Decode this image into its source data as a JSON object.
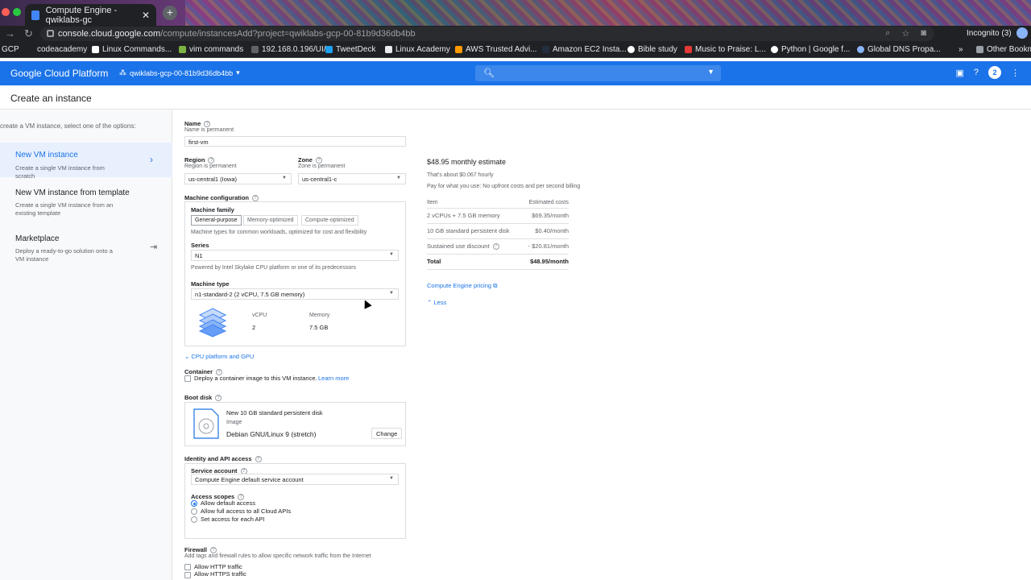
{
  "browser": {
    "tab_title": "Compute Engine - qwiklabs-gc",
    "url_host": "console.cloud.google.com",
    "url_path": "/compute/instancesAdd?project=qwiklabs-gcp-00-81b9d36db4bb",
    "incognito": "Incognito (3)",
    "bookmarks": [
      "GCP",
      "codeacademy",
      "Linux Commands...",
      "vim commands",
      "192.168.0.196/UI/",
      "TweetDeck",
      "Linux Academy",
      "AWS Trusted Advi...",
      "Amazon EC2 Insta...",
      "Bible study",
      "Music to Praise: L...",
      "Python | Google f...",
      "Global DNS Propa...",
      "»",
      "Other Bookm"
    ]
  },
  "header": {
    "title": "Google Cloud Platform",
    "project": "qwiklabs-gcp-00-81b9d36db4bb",
    "notifications": "2"
  },
  "page": {
    "title": "Create an instance"
  },
  "sidebar": {
    "intro": "create a VM instance, select one of the options:",
    "options": [
      {
        "title": "New VM instance",
        "desc": "Create a single VM instance from scratch"
      },
      {
        "title": "New VM instance from template",
        "desc": "Create a single VM instance from an existing template"
      },
      {
        "title": "Marketplace",
        "desc": "Deploy a ready-to-go solution onto a VM instance"
      }
    ]
  },
  "form": {
    "name_label": "Name",
    "name_hint": "Name is permanent",
    "name_value": "first-vm",
    "region_label": "Region",
    "region_hint": "Region is permanent",
    "region_value": "us-central1 (Iowa)",
    "zone_label": "Zone",
    "zone_hint": "Zone is permanent",
    "zone_value": "us-central1-c",
    "machine_config_label": "Machine configuration",
    "machine_family_label": "Machine family",
    "families": [
      "General-purpose",
      "Memory-optimized",
      "Compute-optimized"
    ],
    "family_desc": "Machine types for common workloads, optimized for cost and flexibility",
    "series_label": "Series",
    "series_value": "N1",
    "series_desc": "Powered by Intel Skylake CPU platform or one of its predecessors",
    "machine_type_label": "Machine type",
    "machine_type_value": "n1-standard-2 (2 vCPU, 7.5 GB memory)",
    "vcpu_label": "vCPU",
    "vcpu_value": "2",
    "memory_label": "Memory",
    "memory_value": "7.5 GB",
    "cpu_platform_link": "CPU platform and GPU",
    "container_label": "Container",
    "container_text": "Deploy a container image to this VM instance.",
    "container_link": "Learn more",
    "boot_disk_label": "Boot disk",
    "boot_disk_title": "New 10 GB standard persistent disk",
    "boot_disk_image_label": "Image",
    "boot_disk_image": "Debian GNU/Linux 9 (stretch)",
    "change_button": "Change",
    "identity_label": "Identity and API access",
    "service_account_label": "Service account",
    "service_account_value": "Compute Engine default service account",
    "access_scopes_label": "Access scopes",
    "scopes": [
      "Allow default access",
      "Allow full access to all Cloud APIs",
      "Set access for each API"
    ],
    "firewall_label": "Firewall",
    "firewall_desc": "Add tags and firewall rules to allow specific network traffic from the Internet",
    "firewall_opts": [
      "Allow HTTP traffic",
      "Allow HTTPS traffic"
    ]
  },
  "cost": {
    "estimate": "$48.95 monthly estimate",
    "hourly": "That's about $0.067 hourly",
    "note": "Pay for what you use: No upfront costs and per second billing",
    "col_item": "Item",
    "col_cost": "Estimated costs",
    "rows": [
      {
        "item": "2 vCPUs + 7.5 GB memory",
        "cost": "$69.35/month"
      },
      {
        "item": "10 GB standard persistent disk",
        "cost": "$0.40/month"
      },
      {
        "item": "Sustained use discount",
        "cost": "- $20.81/month"
      },
      {
        "item": "Total",
        "cost": "$48.95/month"
      }
    ],
    "pricing_link": "Compute Engine pricing",
    "less": "Less"
  }
}
